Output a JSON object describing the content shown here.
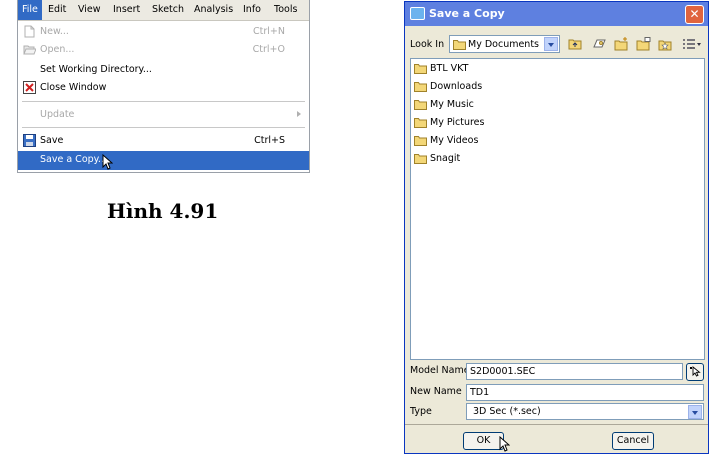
{
  "menu": {
    "bar_items": [
      "File",
      "Edit",
      "View",
      "Insert",
      "Sketch",
      "Analysis",
      "Info",
      "Tools"
    ],
    "active_item": "File",
    "items": [
      {
        "label": "New...",
        "shortcut": "Ctrl+N",
        "state": "disabled",
        "icon": "new-file-icon"
      },
      {
        "label": "Open...",
        "shortcut": "Ctrl+O",
        "state": "disabled",
        "icon": "open-folder-icon"
      },
      {
        "label": "Set Working Directory...",
        "shortcut": "",
        "state": "normal",
        "icon": ""
      },
      {
        "label": "Close Window",
        "shortcut": "",
        "state": "normal",
        "icon": "close-window-icon"
      },
      {
        "label": "Update",
        "shortcut": "",
        "state": "disabled",
        "icon": "",
        "submenu": true
      },
      {
        "label": "Save",
        "shortcut": "Ctrl+S",
        "state": "normal",
        "icon": "save-disk-icon"
      },
      {
        "label": "Save a Copy...",
        "shortcut": "",
        "state": "selected",
        "icon": ""
      }
    ]
  },
  "caption": "Hình 4.91",
  "dialog": {
    "title": "Save a Copy",
    "title_icon": "window-icon",
    "close_glyph": "✕",
    "look_in_label": "Look In",
    "look_in_value": "My Documents",
    "toolbar_icons": [
      "up-folder-icon",
      "working-dir-icon",
      "new-folder-icon",
      "desktop-folder-icon",
      "favorites-folder-icon",
      "list-view-icon"
    ],
    "folders": [
      "BTL VKT",
      "Downloads",
      "My Music",
      "My Pictures",
      "My Videos",
      "Snagit"
    ],
    "model_name_label": "Model Name",
    "model_name_value": "S2D0001.SEC",
    "new_name_label": "New Name",
    "new_name_value": "TD1",
    "type_label": "Type",
    "type_value": "3D Sec (*.sec)",
    "ok_label": "OK",
    "cancel_label": "Cancel",
    "colors": {
      "title_bar": "#5e80e0",
      "selection": "#316ac5",
      "dialog_bg": "#ece9d8",
      "folder": "#f3d778"
    }
  }
}
